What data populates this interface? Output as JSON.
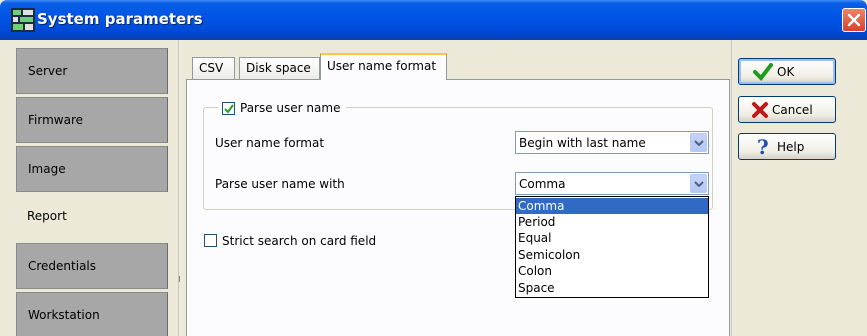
{
  "window": {
    "title": "System parameters",
    "icon": "app-grid-icon",
    "close_icon": "close-icon"
  },
  "nav": {
    "items": [
      {
        "label": "Server",
        "active": false
      },
      {
        "label": "Firmware",
        "active": false
      },
      {
        "label": "Image",
        "active": false
      },
      {
        "label": "Report",
        "active": true
      },
      {
        "label": "Credentials",
        "active": false
      },
      {
        "label": "Workstation",
        "active": false
      }
    ]
  },
  "tabs": [
    {
      "label": "CSV",
      "selected": false
    },
    {
      "label": "Disk space",
      "selected": false
    },
    {
      "label": "User name format",
      "selected": true
    }
  ],
  "parse_group": {
    "checkbox_label": "Parse user name",
    "checked": true,
    "format_label": "User name format",
    "format_value": "Begin with last name",
    "parse_with_label": "Parse user name with",
    "parse_with_value": "Comma"
  },
  "dropdown": {
    "options": [
      "Comma",
      "Period",
      "Equal",
      "Semicolon",
      "Colon",
      "Space"
    ],
    "selected": "Comma"
  },
  "strict_search": {
    "label": "Strict search on card field",
    "checked": false
  },
  "buttons": {
    "ok": "OK",
    "cancel": "Cancel",
    "help": "Help"
  },
  "colors": {
    "titlebar": "#0055e5",
    "selection": "#316ac5",
    "tab_highlight": "#ffc83c"
  }
}
